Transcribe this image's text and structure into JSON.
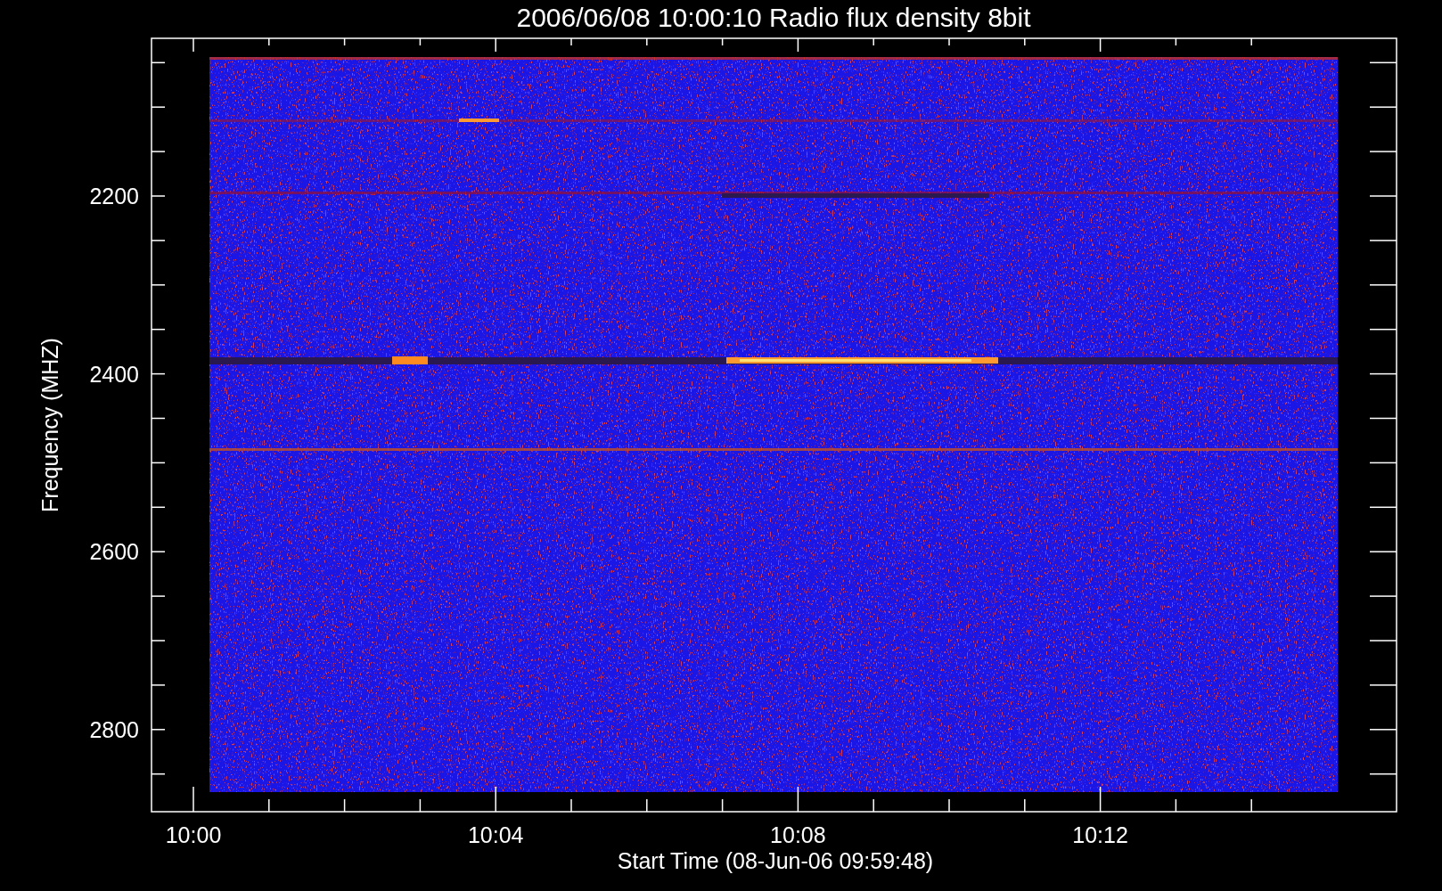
{
  "plot": {
    "title": "2006/06/08 10:00:10 Radio flux density 8bit",
    "ylabel": "Frequency (MHZ)",
    "xlabel": "Start Time (08-Jun-06 09:59:48)",
    "yticks": [
      {
        "label": "2200"
      },
      {
        "label": "2400"
      },
      {
        "label": "2600"
      },
      {
        "label": "2800"
      }
    ],
    "xticks": [
      {
        "label": "10:00"
      },
      {
        "label": "10:04"
      },
      {
        "label": "10:08"
      },
      {
        "label": "10:12"
      }
    ]
  }
}
